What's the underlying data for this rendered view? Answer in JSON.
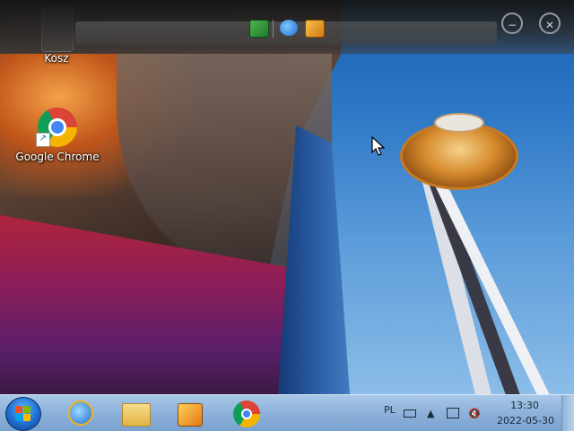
{
  "desktop": {
    "icons": [
      {
        "label": "Kosz"
      },
      {
        "label": "Google Chrome"
      }
    ]
  },
  "top_toolbar": {
    "buttons": [
      {
        "icon": "server-icon"
      },
      {
        "icon": "internet-explorer-icon"
      },
      {
        "icon": "media-player-icon"
      }
    ],
    "window_controls": [
      {
        "icon": "minimize-icon",
        "glyph": "−"
      },
      {
        "icon": "close-icon",
        "glyph": "✕"
      }
    ]
  },
  "taskbar": {
    "start_button": {
      "icon": "windows-logo-icon"
    },
    "pinned": [
      {
        "icon": "internet-explorer-icon"
      },
      {
        "icon": "file-explorer-icon"
      },
      {
        "icon": "media-player-icon"
      },
      {
        "icon": "chrome-icon"
      }
    ],
    "tray": {
      "language": "PL",
      "icons": [
        "keyboard-icon",
        "show-hidden-icons-icon",
        "network-icon",
        "volume-muted-icon"
      ],
      "time": "13:30",
      "date": "2022-05-30"
    }
  },
  "colors": {
    "taskbar": "#8fb3db",
    "toolbar": "#2a2a2a",
    "sky": "#2f79c7"
  }
}
